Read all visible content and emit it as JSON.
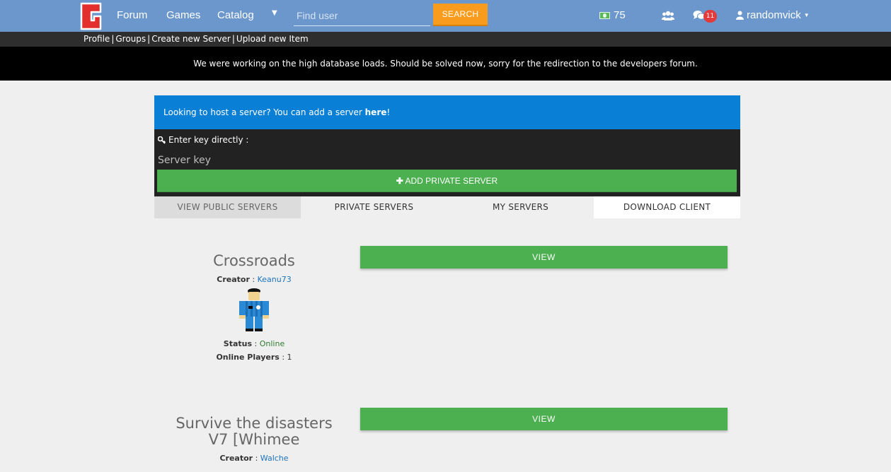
{
  "navbar": {
    "brand_letter": "G",
    "links": [
      "Forum",
      "Games",
      "Catalog"
    ],
    "search_placeholder": "Find user",
    "search_button": "SEARCH",
    "currency_amount": "75",
    "notification_count": "11",
    "username": "randomvick"
  },
  "subnav": {
    "links": [
      "Profile",
      "Groups",
      "Create new Server",
      "Upload new Item"
    ]
  },
  "announcement": "We were working on the high database loads. Should be solved now, sorry for the redirection to the developers forum.",
  "host_notice": {
    "text_before": "Looking to host a server? You can add a server ",
    "link": "here",
    "text_after": "!"
  },
  "key_panel": {
    "label": "Enter key directly :",
    "placeholder": "Server key",
    "add_button": "ADD PRIVATE SERVER"
  },
  "tabs": [
    "VIEW PUBLIC SERVERS",
    "PRIVATE SERVERS",
    "MY SERVERS",
    "DOWNLOAD CLIENT"
  ],
  "servers": [
    {
      "name": "Crossroads",
      "creator_label": "Creator",
      "creator": "Keanu73",
      "status_label": "Status",
      "status": "Online",
      "players_label": "Online Players",
      "players": "1",
      "view_button": "VIEW"
    },
    {
      "name": "Survive the disasters V7 [Whimee",
      "creator_label": "Creator",
      "creator": "Walche",
      "view_button": "VIEW"
    }
  ],
  "colors": {
    "navbar": "#6b97cc",
    "search_button": "#f99b1c",
    "info_box": "#0a7fd6",
    "green_button": "#4caf50"
  }
}
